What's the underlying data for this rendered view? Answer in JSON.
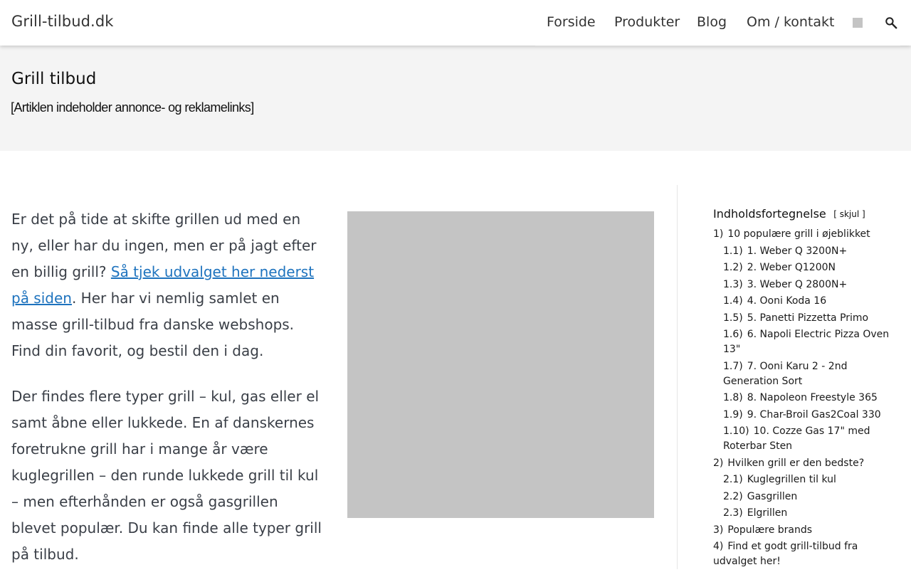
{
  "header": {
    "logo": "Grill-tilbud.dk",
    "nav": [
      "Forside",
      "Produkter",
      "Blog",
      "Om / kontakt"
    ]
  },
  "titlebar": {
    "title": "Grill tilbud",
    "disclaimer": "[Artiklen indeholder annonce- og reklamelinks]"
  },
  "main": {
    "p1_before": "Er det på tide at skifte grillen ud med en ny, eller har du ingen, men er på jagt efter en billig grill? ",
    "p1_link": "Så tjek udvalget her nederst på siden",
    "p1_after": ". Her har vi nemlig samlet en masse grill-tilbud fra danske webshops. Find din favorit, og bestil den i dag.",
    "p2": "Der findes flere typer grill – kul, gas eller el samt åbne eller lukkede. En af danskernes foretrukne grill har i mange år være kuglegrillen – den runde lukkede grill til kul – men efterhånden er også gasgrillen blevet populær. Du kan finde alle typer grill på tilbud."
  },
  "toc": {
    "title": "Indholdsfortegnelse",
    "toggle_open": "[",
    "toggle_label": "skjul",
    "toggle_close": "]",
    "items": [
      {
        "num": "1)",
        "label": "10 populære grill i øjeblikket",
        "sub": false
      },
      {
        "num": "1.1)",
        "label": "1. Weber Q 3200N+",
        "sub": true
      },
      {
        "num": "1.2)",
        "label": "2. Weber Q1200N",
        "sub": true
      },
      {
        "num": "1.3)",
        "label": "3. Weber Q 2800N+",
        "sub": true
      },
      {
        "num": "1.4)",
        "label": "4. Ooni Koda 16",
        "sub": true
      },
      {
        "num": "1.5)",
        "label": "5. Panetti Pizzetta Primo",
        "sub": true
      },
      {
        "num": "1.6)",
        "label": "6. Napoli Electric Pizza Oven 13\"",
        "sub": true
      },
      {
        "num": "1.7)",
        "label": "7. Ooni Karu 2 - 2nd Generation Sort",
        "sub": true
      },
      {
        "num": "1.8)",
        "label": "8. Napoleon Freestyle 365",
        "sub": true
      },
      {
        "num": "1.9)",
        "label": "9. Char-Broil Gas2Coal 330",
        "sub": true
      },
      {
        "num": "1.10)",
        "label": "10. Cozze Gas 17\" med Roterbar Sten",
        "sub": true
      },
      {
        "num": "2)",
        "label": "Hvilken grill er den bedste?",
        "sub": false
      },
      {
        "num": "2.1)",
        "label": "Kuglegrillen til kul",
        "sub": true
      },
      {
        "num": "2.2)",
        "label": "Gasgrillen",
        "sub": true
      },
      {
        "num": "2.3)",
        "label": "Elgrillen",
        "sub": true
      },
      {
        "num": "3)",
        "label": "Populære brands",
        "sub": false
      },
      {
        "num": "4)",
        "label": "Find et godt grill-tilbud fra udvalget her!",
        "sub": false
      }
    ]
  },
  "icons": {
    "search": "search-icon",
    "nav_square": "placeholder-square-icon"
  },
  "colors": {
    "link": "#1e73be",
    "titlebar_bg": "#f4f4f4",
    "image_placeholder": "#c4c4c4"
  }
}
